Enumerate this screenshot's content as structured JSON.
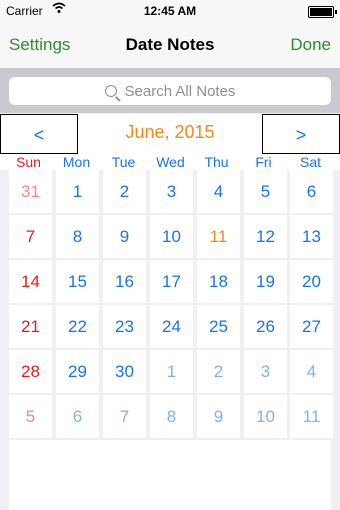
{
  "status": {
    "carrier": "Carrier",
    "time": "12:45 AM"
  },
  "nav": {
    "left": "Settings",
    "title": "Date Notes",
    "right": "Done"
  },
  "search": {
    "placeholder": "Search All Notes"
  },
  "calendar": {
    "prev": "<",
    "next": ">",
    "month": "June, 2015",
    "weekdays": [
      "Sun",
      "Mon",
      "Tue",
      "Wed",
      "Thu",
      "Fri",
      "Sat"
    ],
    "weeks": [
      [
        {
          "d": "31",
          "t": "sunfaded"
        },
        {
          "d": "1",
          "t": "cur"
        },
        {
          "d": "2",
          "t": "cur"
        },
        {
          "d": "3",
          "t": "cur"
        },
        {
          "d": "4",
          "t": "cur"
        },
        {
          "d": "5",
          "t": "cur"
        },
        {
          "d": "6",
          "t": "cur"
        }
      ],
      [
        {
          "d": "7",
          "t": "sun"
        },
        {
          "d": "8",
          "t": "cur"
        },
        {
          "d": "9",
          "t": "cur"
        },
        {
          "d": "10",
          "t": "cur"
        },
        {
          "d": "11",
          "t": "today"
        },
        {
          "d": "12",
          "t": "cur"
        },
        {
          "d": "13",
          "t": "cur"
        }
      ],
      [
        {
          "d": "14",
          "t": "sun"
        },
        {
          "d": "15",
          "t": "cur"
        },
        {
          "d": "16",
          "t": "cur"
        },
        {
          "d": "17",
          "t": "cur"
        },
        {
          "d": "18",
          "t": "cur"
        },
        {
          "d": "19",
          "t": "cur"
        },
        {
          "d": "20",
          "t": "cur"
        }
      ],
      [
        {
          "d": "21",
          "t": "sun"
        },
        {
          "d": "22",
          "t": "cur"
        },
        {
          "d": "23",
          "t": "cur"
        },
        {
          "d": "24",
          "t": "cur"
        },
        {
          "d": "25",
          "t": "cur"
        },
        {
          "d": "26",
          "t": "cur"
        },
        {
          "d": "27",
          "t": "cur"
        }
      ],
      [
        {
          "d": "28",
          "t": "sun"
        },
        {
          "d": "29",
          "t": "cur"
        },
        {
          "d": "30",
          "t": "cur"
        },
        {
          "d": "1",
          "t": "faded"
        },
        {
          "d": "2",
          "t": "faded"
        },
        {
          "d": "3",
          "t": "faded"
        },
        {
          "d": "4",
          "t": "faded"
        }
      ],
      [
        {
          "d": "5",
          "t": "sunfaded"
        },
        {
          "d": "6",
          "t": "faded"
        },
        {
          "d": "7",
          "t": "faded"
        },
        {
          "d": "8",
          "t": "faded"
        },
        {
          "d": "9",
          "t": "faded"
        },
        {
          "d": "10",
          "t": "faded"
        },
        {
          "d": "11",
          "t": "faded"
        }
      ]
    ]
  },
  "colors": {
    "accent_green": "#2e8b2e",
    "blue": "#1a73e8",
    "sunday_red": "#e02020",
    "orange": "#f5871f"
  }
}
